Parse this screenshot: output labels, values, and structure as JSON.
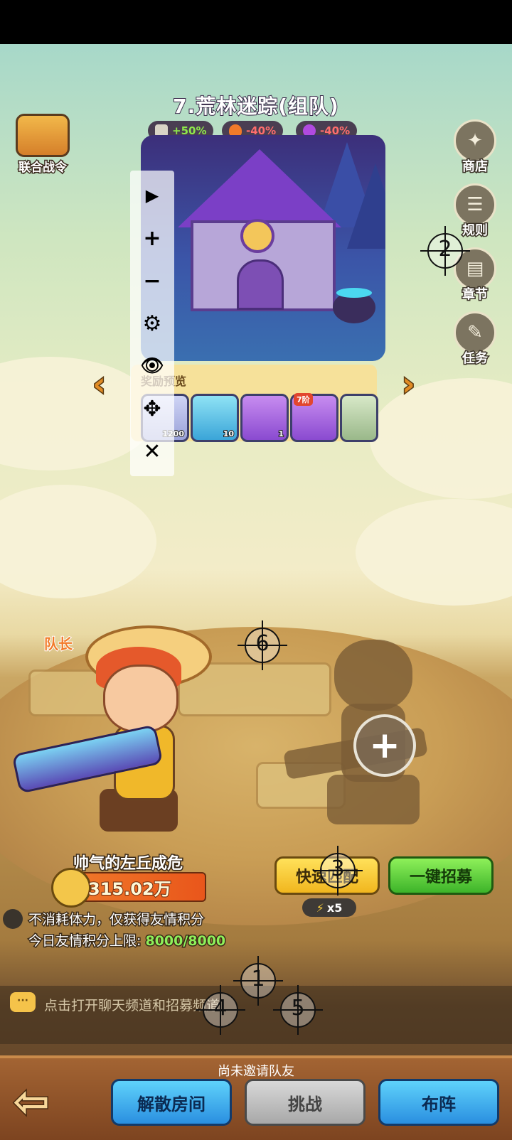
{
  "stage": {
    "title": "7.荒林迷踪(组队)",
    "buffs": [
      {
        "icon": "sword-icon",
        "value": "+50%",
        "type": "up"
      },
      {
        "icon": "fire-icon",
        "value": "-40%",
        "type": "down"
      },
      {
        "icon": "potion-icon",
        "value": "-40%",
        "type": "down"
      }
    ]
  },
  "battle_pass": {
    "label": "联合战令"
  },
  "side_menu": [
    {
      "label": "商店",
      "icon": "shop-icon"
    },
    {
      "label": "规则",
      "icon": "rules-icon"
    },
    {
      "label": "章节",
      "icon": "book-icon"
    },
    {
      "label": "任务",
      "icon": "quest-icon"
    }
  ],
  "rewards": {
    "title": "奖励预览",
    "items": [
      {
        "count": "1200",
        "badge": ""
      },
      {
        "count": "10",
        "badge": ""
      },
      {
        "count": "1",
        "badge": ""
      },
      {
        "count": "",
        "badge": "7阶"
      },
      {
        "count": "",
        "badge": ""
      }
    ]
  },
  "toolbar": {
    "play": "▶",
    "zoom_in": "+",
    "zoom_out": "−",
    "settings": "⚙",
    "hide": "👁",
    "move": "✥",
    "close": "✕"
  },
  "markers": [
    "1",
    "2",
    "3",
    "4",
    "5",
    "6"
  ],
  "captain": {
    "tag": "队长",
    "name": "帅气的左丘成危",
    "power": "315.02万"
  },
  "actions": {
    "quick_match": "快速匹配",
    "one_click_recruit": "一键招募",
    "energy_cost": "x5"
  },
  "info": {
    "line1": "不消耗体力，仅获得友情积分",
    "line2_prefix": "今日友情积分上限: ",
    "line2_value": "8000/8000"
  },
  "chat": {
    "placeholder": "点击打开聊天频道和招募频道"
  },
  "bottom": {
    "status": "尚未邀请队友",
    "disband": "解散房间",
    "challenge": "挑战",
    "formation": "布阵"
  },
  "colors": {
    "accent_yellow": "#f1b61e",
    "accent_green": "#3db42a",
    "accent_blue": "#2a8fe0",
    "friendship_green": "#8ef05a"
  }
}
